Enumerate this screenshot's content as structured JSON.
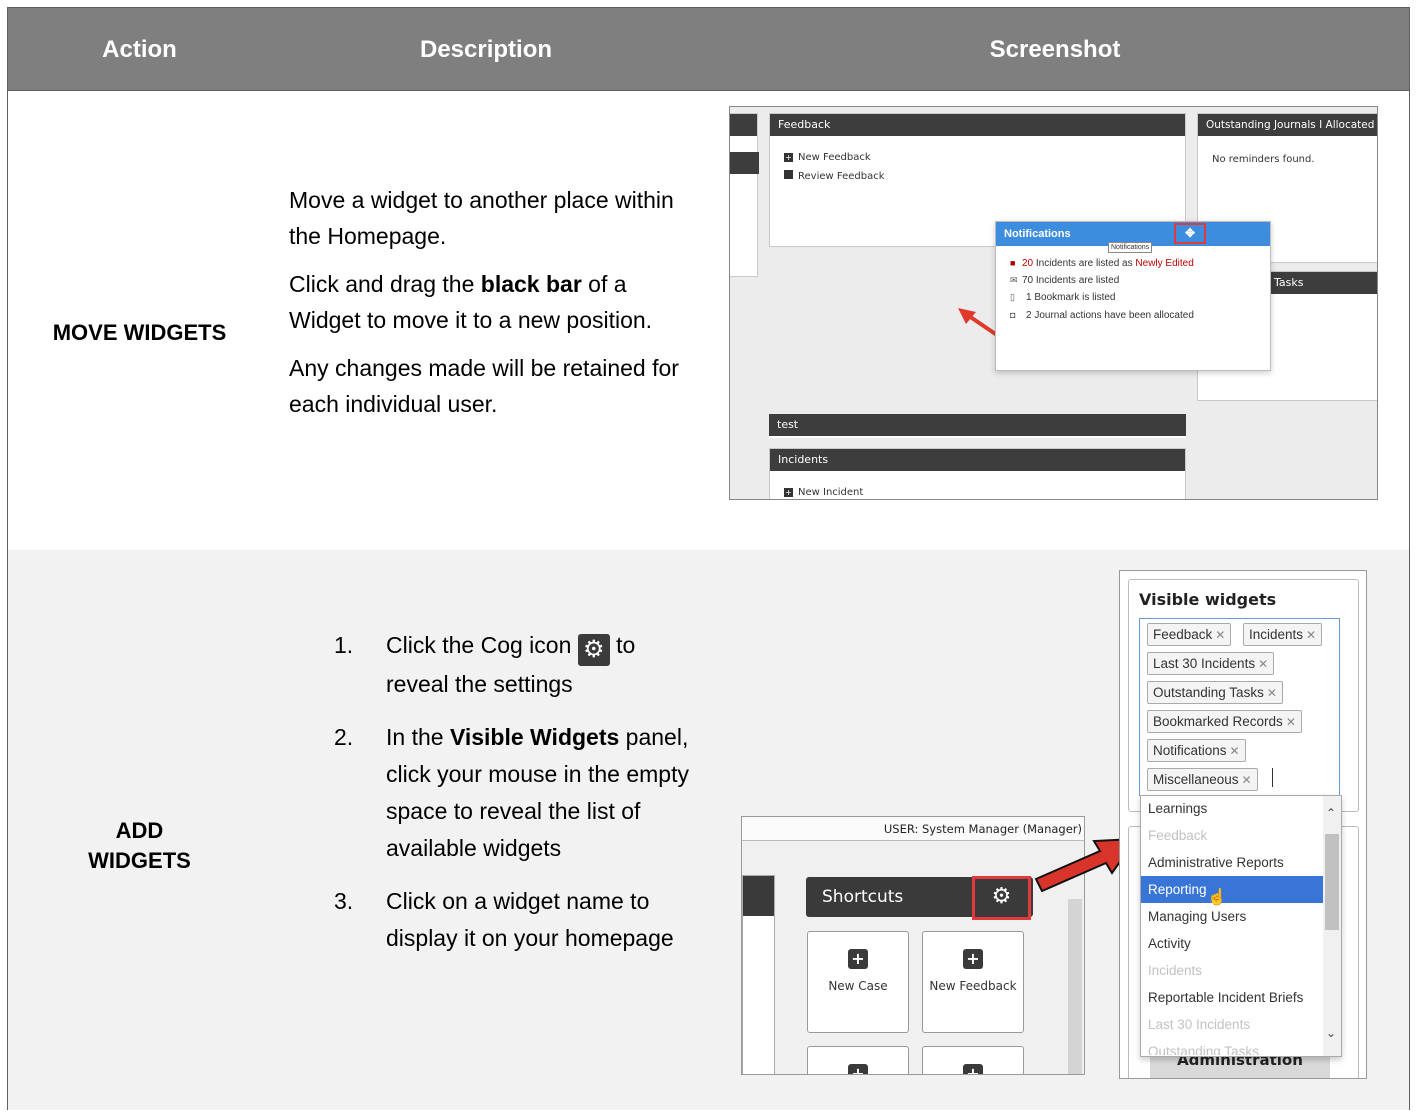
{
  "header": {
    "col_action": "Action",
    "col_description": "Description",
    "col_screenshot": "Screenshot"
  },
  "row_move": {
    "action": "MOVE WIDGETS",
    "desc_p1": "Move a widget to another place within the Homepage.",
    "desc_p2_pre": "Click and drag the ",
    "desc_p2_bold": "black bar",
    "desc_p2_post": " of a Widget to move it to a new position.",
    "desc_p3": "Any changes made will be retained for each individual user.",
    "screenshot": {
      "feedback_title": "Feedback",
      "new_feedback": "New Feedback",
      "review_feedback": "Review Feedback",
      "outstanding_title": "Outstanding Journals I Allocated",
      "no_reminders": "No reminders found.",
      "tasks_title": "Tasks",
      "notifications_title": "Notifications",
      "notifications_tooltip": "Notifications",
      "notif_1_count": "20",
      "notif_1_text": " Incidents are listed as ",
      "notif_1_status": "Newly Edited",
      "notif_2": "70 Incidents are listed",
      "notif_3": "1 Bookmark is listed",
      "notif_4": "2 Journal actions have been allocated",
      "test_title": "test",
      "incidents_title": "Incidents",
      "new_incident": "New Incident",
      "status_color": "#c00000",
      "notif_bar_color": "#3c8dde"
    }
  },
  "row_add": {
    "action_line1": "ADD",
    "action_line2": "WIDGETS",
    "step1_num": "1.",
    "step1_pre": "Click the Cog icon ",
    "step1_post": " to reveal the settings",
    "step2_num": "2.",
    "step2_pre": "In the ",
    "step2_bold": "Visible Widgets",
    "step2_post": " panel, click your mouse in the empty space to reveal the list of available widgets",
    "step3_num": "3.",
    "step3_text": "Click on a widget name to display it on your homepage",
    "screenshot_left": {
      "user_label": "USER: System Manager (Manager)",
      "shortcuts_title": "Shortcuts",
      "tile_1": "New Case",
      "tile_2": "New Feedback"
    },
    "screenshot_right": {
      "panel_title": "Visible widgets",
      "tags": [
        "Feedback",
        "Incidents",
        "Last 30 Incidents",
        "Outstanding Tasks",
        "Bookmarked Records",
        "Notifications",
        "Miscellaneous"
      ],
      "options": [
        {
          "label": "Learnings",
          "state": "normal"
        },
        {
          "label": "Feedback",
          "state": "disabled"
        },
        {
          "label": "Administrative Reports",
          "state": "normal"
        },
        {
          "label": "Reporting",
          "state": "selected"
        },
        {
          "label": "Managing Users",
          "state": "normal"
        },
        {
          "label": "Activity",
          "state": "normal"
        },
        {
          "label": "Incidents",
          "state": "disabled"
        },
        {
          "label": "Reportable Incident Briefs",
          "state": "normal"
        },
        {
          "label": "Last 30 Incidents",
          "state": "disabled"
        },
        {
          "label": "Outstanding Tasks",
          "state": "disabled"
        }
      ],
      "behind_label": "Administration",
      "selected_color": "#3875d7"
    }
  },
  "icons": {
    "cog": "cog-icon",
    "arrow": "arrow-icon",
    "move": "move-icon",
    "plus": "plus-icon",
    "hand_cursor": "hand-cursor-icon"
  }
}
